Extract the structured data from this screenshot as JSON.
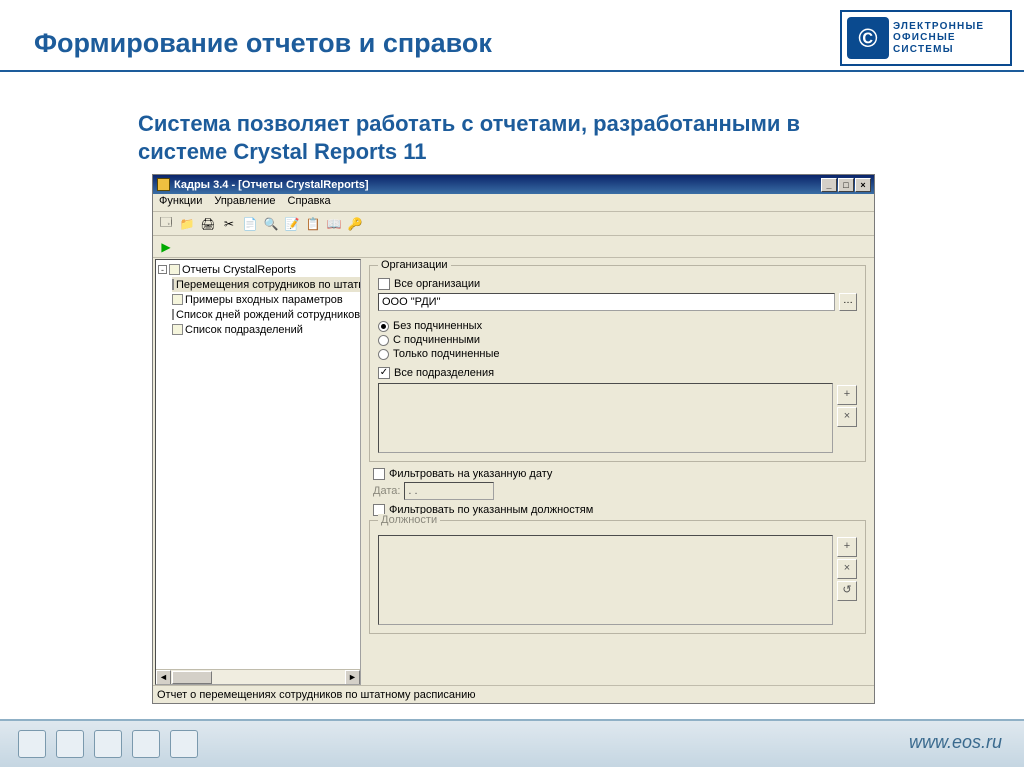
{
  "slide": {
    "title": "Формирование отчетов и справок",
    "intro": "Система позволяет работать с отчетами, разработанными  в системе Crystal Reports 11",
    "footer_url": "www.eos.ru",
    "logo": {
      "line1": "ЭЛЕКТРОННЫЕ",
      "line2": "ОФИСНЫЕ",
      "line3": "СИСТЕМЫ"
    }
  },
  "window": {
    "title": "Кадры 3.4 - [Отчеты CrystalReports]",
    "menu": {
      "m1": "Функции",
      "m2": "Управление",
      "m3": "Справка"
    },
    "tree": {
      "root": "Отчеты CrystalReports",
      "items": [
        "Перемещения сотрудников по штатному",
        "Примеры входных параметров",
        "Список дней рождений сотрудников с вы",
        "Список подразделений"
      ]
    },
    "form": {
      "org_legend": "Организации",
      "all_orgs": "Все организации",
      "org_value": "ООО \"РДИ\"",
      "r1": "Без подчиненных",
      "r2": "С подчиненными",
      "r3": "Только подчиненные",
      "all_depts": "Все подразделения",
      "filter_date": "Фильтровать на указанную дату",
      "date_label": "Дата:",
      "date_value": ". .",
      "filter_pos": "Фильтровать по указанным должностям",
      "pos_legend": "Должности"
    },
    "status": "Отчет о перемещениях сотрудников по штатному расписанию"
  }
}
